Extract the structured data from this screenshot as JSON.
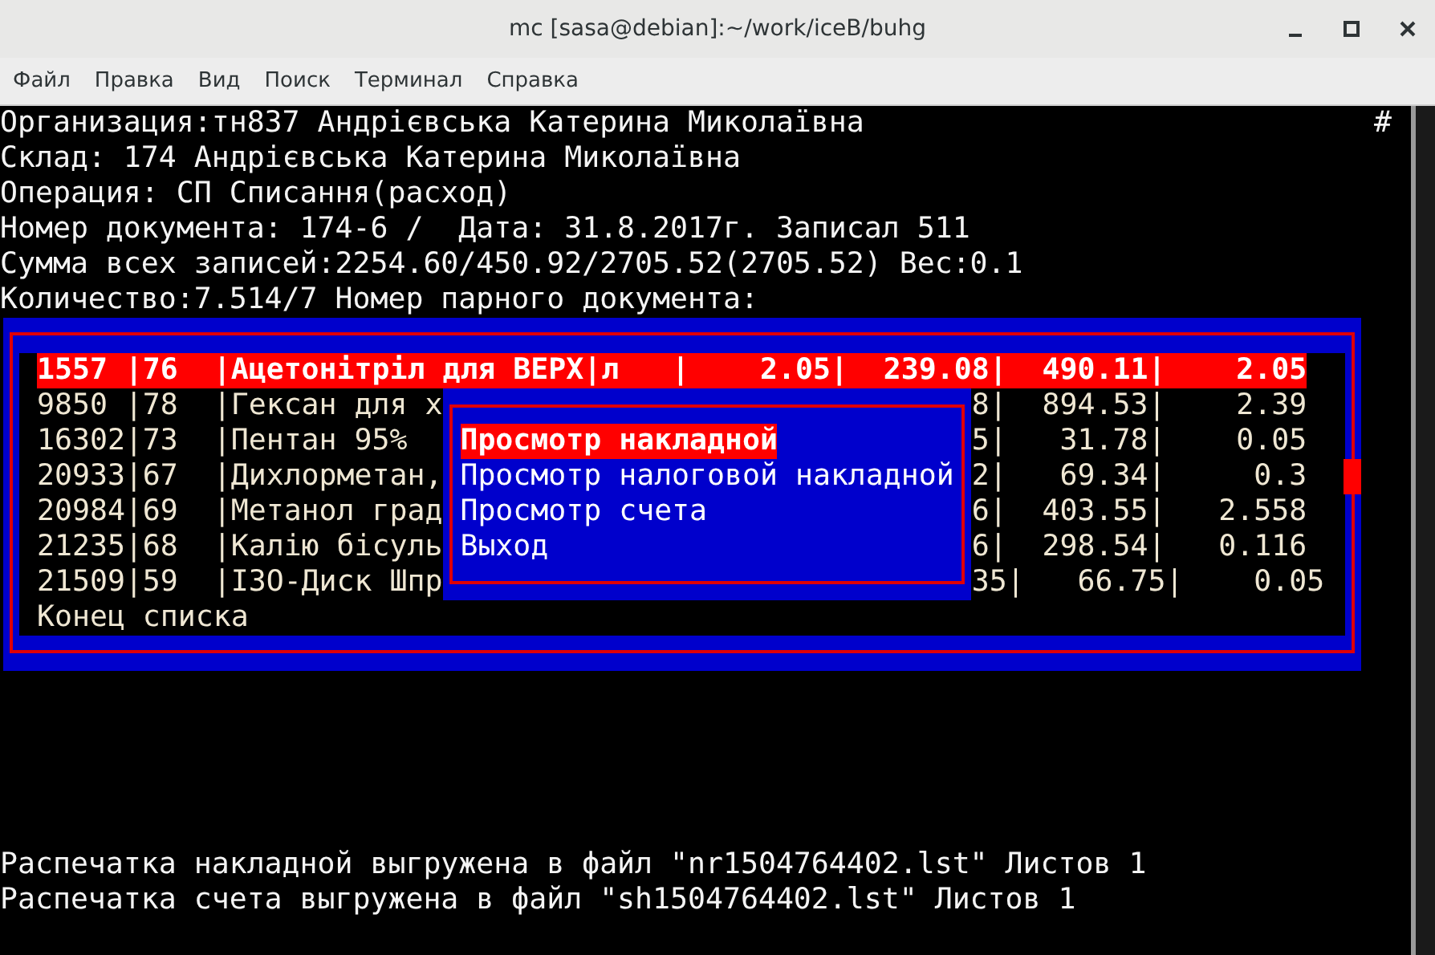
{
  "window": {
    "title": "mc [sasa@debian]:~/work/iceB/buhg"
  },
  "menu": [
    "Файл",
    "Правка",
    "Вид",
    "Поиск",
    "Терминал",
    "Справка"
  ],
  "terminal": {
    "lines_top": [
      "Организация:тн837 Андрієвська Катерина Миколаївна",
      "Склад: 174 Андрієвська Катерина Миколаївна",
      "Операция: СП Списання(расход)",
      "Номер документа: 174-6 /  Дата: 31.8.2017г. Записал 511",
      "Сумма всех записей:2254.60/450.92/2705.52(2705.52) Вес:0.1",
      "Количество:7.514/7 Номер парного документа:"
    ],
    "corner_mark": "#",
    "list": {
      "rows": [
        {
          "text": "1557 |76  |Ацетонітріл для ВЕРХ|л   |    2.05|  239.08|  490.11|    2.05",
          "selected": true
        },
        {
          "text": "9850 |78  |Гексан для х",
          "text_right": "8|  894.53|    2.39",
          "selected": false
        },
        {
          "text": "16302|73  |Пентан 95%",
          "text_right": "5|   31.78|    0.05",
          "selected": false
        },
        {
          "text": "20933|67  |Дихлорметан,",
          "text_right": "2|   69.34|     0.3",
          "selected": false
        },
        {
          "text": "20984|69  |Метанол град",
          "text_right": "6|  403.55|   2.558",
          "selected": false
        },
        {
          "text": "21235|68  |Калію бісуль",
          "text_right": "6|  298.54|   0.116",
          "selected": false
        },
        {
          "text": "21509|59  |ІЗО-Диск Шпр",
          "text_right": "35|   66.75|    0.05",
          "selected": false
        }
      ],
      "end_text": "Конец списка"
    },
    "popup": {
      "items": [
        {
          "label": "Просмотр накладной",
          "selected": true
        },
        {
          "label": "Просмотр налоговой накладной",
          "selected": false
        },
        {
          "label": "Просмотр счета",
          "selected": false
        },
        {
          "label": "Выход",
          "selected": false
        }
      ]
    },
    "lines_bottom": [
      "Распечатка накладной выгружена в файл \"nr1504764402.lst\" Листов 1",
      "Распечатка счета выгружена в файл \"sh1504764402.lst\" Листов 1"
    ]
  }
}
